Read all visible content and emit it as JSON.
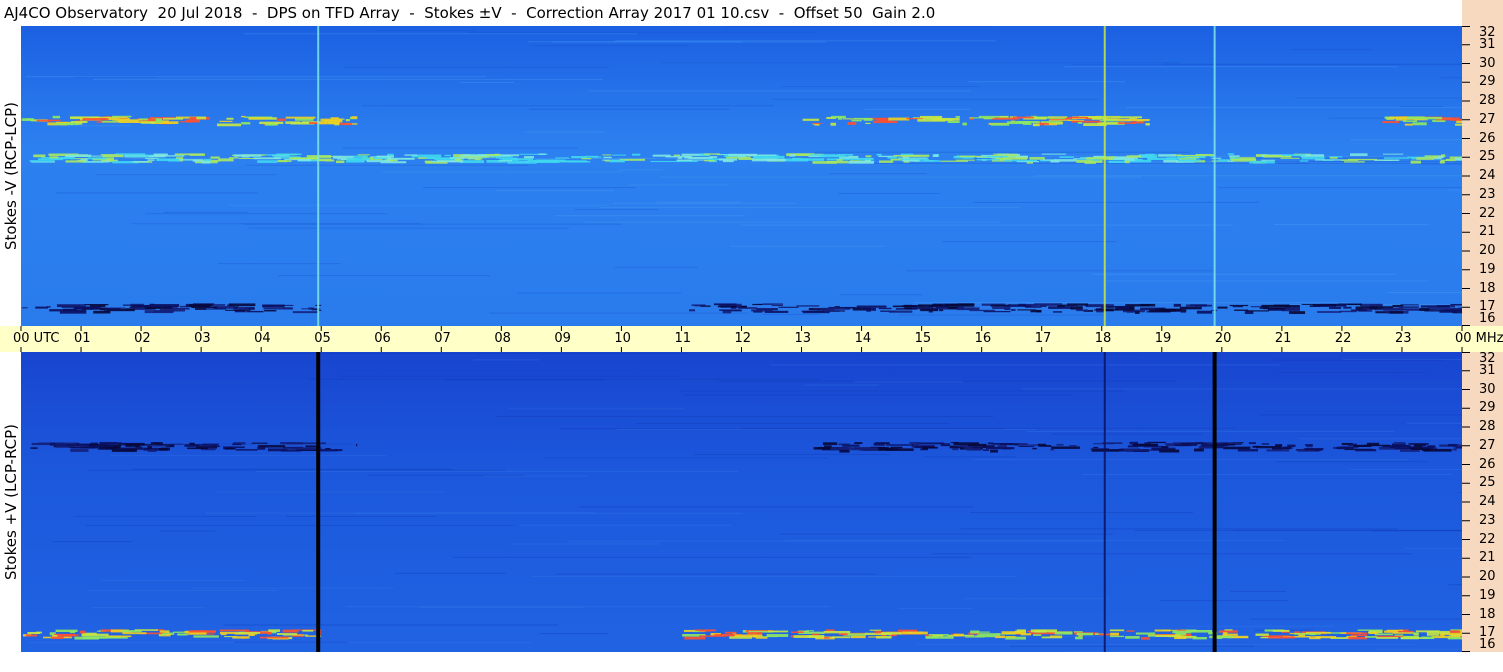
{
  "title": "AJ4CO Observatory  20 Jul 2018  -  DPS on TFD Array  -  Stokes ±V  -  Correction Array 2017 01 10.csv  -  Offset 50  Gain 2.0",
  "panels": {
    "top_label": "Stokes -V (RCP-LCP)",
    "bottom_label": "Stokes +V (LCP-RCP)"
  },
  "time_axis": {
    "ticks": [
      "00 UTC",
      "01",
      "02",
      "03",
      "04",
      "05",
      "06",
      "07",
      "08",
      "09",
      "10",
      "11",
      "12",
      "13",
      "14",
      "15",
      "16",
      "17",
      "18",
      "19",
      "20",
      "21",
      "22",
      "23",
      "00 MHz"
    ]
  },
  "freq_axis": {
    "ticks": [
      "32",
      "31",
      "30",
      "29",
      "28",
      "27",
      "26",
      "25",
      "24",
      "23",
      "22",
      "21",
      "20",
      "19",
      "18",
      "17",
      "16"
    ]
  },
  "chart_data": [
    {
      "type": "heatmap",
      "title": "Stokes -V (RCP-LCP)",
      "xlabel": "UTC",
      "ylabel": "MHz",
      "xlim": [
        0,
        24
      ],
      "ylim": [
        16,
        32
      ],
      "x_ticks": [
        "00",
        "01",
        "02",
        "03",
        "04",
        "05",
        "06",
        "07",
        "08",
        "09",
        "10",
        "11",
        "12",
        "13",
        "14",
        "15",
        "16",
        "17",
        "18",
        "19",
        "20",
        "21",
        "22",
        "23",
        "00"
      ],
      "y_ticks": [
        32,
        31,
        30,
        29,
        28,
        27,
        26,
        25,
        24,
        23,
        22,
        21,
        20,
        19,
        18,
        17,
        16
      ],
      "colors": {
        "background": "#1f6ae8",
        "strong": "#e8e838",
        "peak": "#ff4020",
        "weak": "#0b1a80"
      },
      "features": [
        {
          "kind": "horizontal_band",
          "mhz": 27.0,
          "x_from": 0.0,
          "x_to": 5.6,
          "intensity": "high"
        },
        {
          "kind": "horizontal_band",
          "mhz": 27.0,
          "x_from": 13.0,
          "x_to": 18.8,
          "intensity": "high"
        },
        {
          "kind": "horizontal_band",
          "mhz": 27.0,
          "x_from": 22.5,
          "x_to": 24.0,
          "intensity": "high"
        },
        {
          "kind": "horizontal_band",
          "mhz": 25.0,
          "x_from": 0.0,
          "x_to": 24.0,
          "intensity": "medium"
        },
        {
          "kind": "horizontal_band",
          "mhz": 17.0,
          "x_from": 11.0,
          "x_to": 24.0,
          "intensity": "low_dark"
        },
        {
          "kind": "horizontal_band",
          "mhz": 17.0,
          "x_from": 0.0,
          "x_to": 5.0,
          "intensity": "low_dark"
        },
        {
          "kind": "vertical_line",
          "utc": 4.95,
          "intensity": "medium"
        },
        {
          "kind": "vertical_line",
          "utc": 18.05,
          "intensity": "high"
        },
        {
          "kind": "vertical_line",
          "utc": 19.88,
          "intensity": "medium"
        }
      ]
    },
    {
      "type": "heatmap",
      "title": "Stokes +V (LCP-RCP)",
      "xlabel": "UTC",
      "ylabel": "MHz",
      "xlim": [
        0,
        24
      ],
      "ylim": [
        16,
        32
      ],
      "x_ticks": [
        "00",
        "01",
        "02",
        "03",
        "04",
        "05",
        "06",
        "07",
        "08",
        "09",
        "10",
        "11",
        "12",
        "13",
        "14",
        "15",
        "16",
        "17",
        "18",
        "19",
        "20",
        "21",
        "22",
        "23",
        "00"
      ],
      "y_ticks": [
        32,
        31,
        30,
        29,
        28,
        27,
        26,
        25,
        24,
        23,
        22,
        21,
        20,
        19,
        18,
        17,
        16
      ],
      "colors": {
        "background": "#1c58dc",
        "strong": "#e8e838",
        "peak": "#ff4020",
        "weak": "#0a1060"
      },
      "features": [
        {
          "kind": "horizontal_band",
          "mhz": 27.0,
          "x_from": 0.0,
          "x_to": 5.6,
          "intensity": "low_dark"
        },
        {
          "kind": "horizontal_band",
          "mhz": 27.0,
          "x_from": 13.0,
          "x_to": 24.0,
          "intensity": "low_dark"
        },
        {
          "kind": "horizontal_band",
          "mhz": 17.0,
          "x_from": 11.0,
          "x_to": 24.0,
          "intensity": "high"
        },
        {
          "kind": "horizontal_band",
          "mhz": 17.0,
          "x_from": 0.0,
          "x_to": 5.0,
          "intensity": "high"
        },
        {
          "kind": "vertical_line",
          "utc": 4.95,
          "intensity": "blank"
        },
        {
          "kind": "vertical_line",
          "utc": 18.05,
          "intensity": "low_dark"
        },
        {
          "kind": "vertical_line",
          "utc": 19.88,
          "intensity": "blank"
        }
      ]
    }
  ]
}
